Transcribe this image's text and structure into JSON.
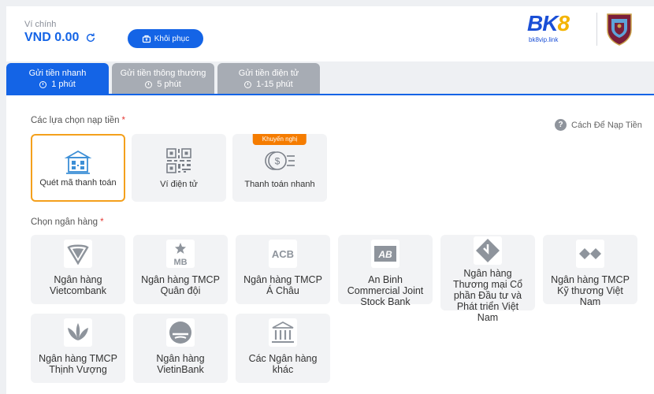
{
  "wallet": {
    "label": "Ví chính",
    "balance": "VND 0.00",
    "restore_label": "Khôi phục"
  },
  "brand": {
    "bk8_prefix": "BK",
    "bk8_eight": "8",
    "link": "bk8vip.link"
  },
  "tabs": [
    {
      "title": "Gửi tiền nhanh",
      "time": "1 phút",
      "active": true
    },
    {
      "title": "Gửi tiền thông thường",
      "time": "5 phút",
      "active": false
    },
    {
      "title": "Gửi tiền điện tử",
      "time": "1-15 phút",
      "active": false
    }
  ],
  "deposit": {
    "section_label": "Các lựa chọn nạp tiền",
    "required_mark": "*",
    "howto_label": "Cách Để Nạp Tiền",
    "help_glyph": "?",
    "options": [
      {
        "label": "Quét mã thanh toán",
        "icon": "qr-bank-icon",
        "selected": true
      },
      {
        "label": "Ví điện tử",
        "icon": "qr-code-icon",
        "selected": false
      },
      {
        "label": "Thanh toán nhanh",
        "icon": "fast-payment-icon",
        "selected": false,
        "badge": "Khuyến nghị"
      }
    ]
  },
  "banks": {
    "section_label": "Chọn ngân hàng",
    "required_mark": "*",
    "items": [
      {
        "name": "Ngân hàng Vietcombank",
        "icon": "vietcombank-icon"
      },
      {
        "name": "Ngân hàng TMCP Quân đội",
        "icon": "mb-bank-icon",
        "logo_text": "MB"
      },
      {
        "name": "Ngân hàng TMCP Á Châu",
        "icon": "acb-icon",
        "logo_text": "ACB"
      },
      {
        "name": "An Binh Commercial Joint Stock Bank",
        "icon": "abbank-icon",
        "logo_text": "AB"
      },
      {
        "name": "Ngân hàng Thương mại Cổ phần Đầu tư và Phát triển Việt Nam",
        "icon": "bidv-icon"
      },
      {
        "name": "Ngân hàng TMCP Kỹ thương Việt Nam",
        "icon": "techcombank-icon"
      },
      {
        "name": "Ngân hàng TMCP Thịnh Vượng",
        "icon": "vpbank-icon"
      },
      {
        "name": "Ngân hàng VietinBank",
        "icon": "vietinbank-icon"
      },
      {
        "name": "Các Ngân hàng khác",
        "icon": "other-bank-icon"
      }
    ]
  }
}
